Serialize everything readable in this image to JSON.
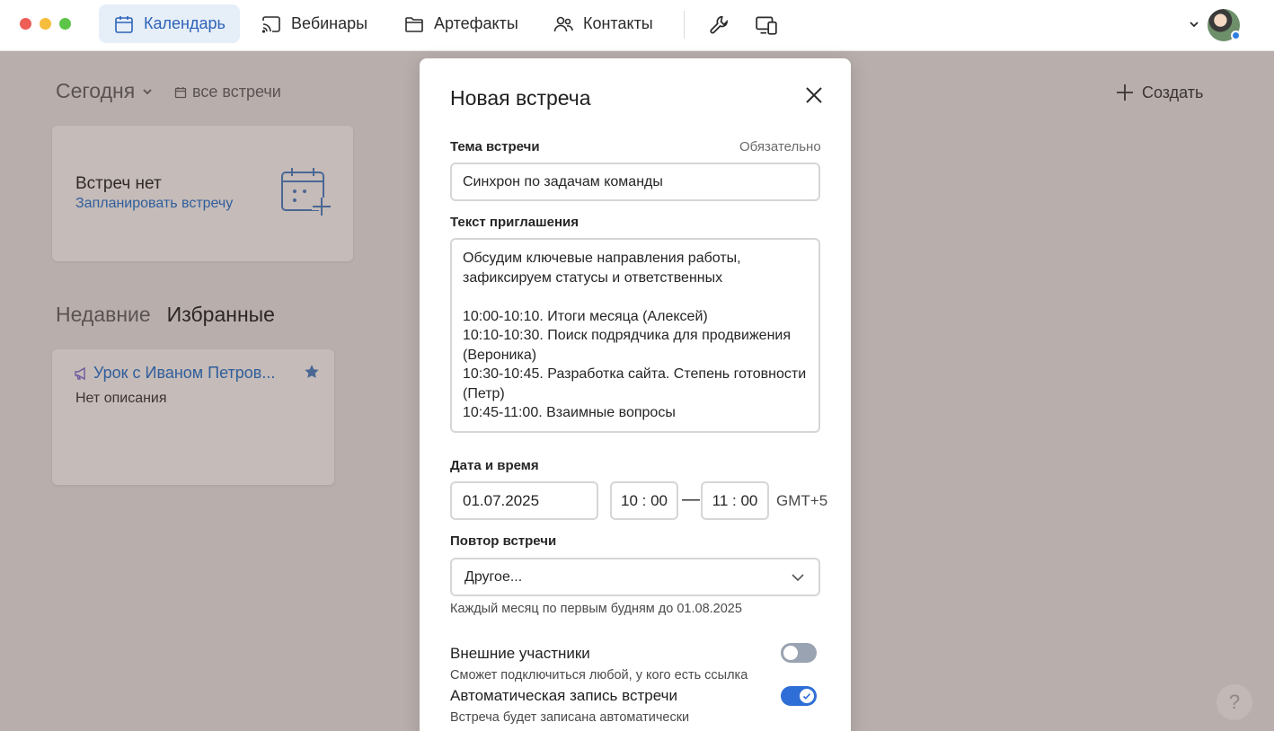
{
  "nav": {
    "items": [
      {
        "label": "Календарь",
        "icon": "calendar-icon",
        "active": true
      },
      {
        "label": "Вебинары",
        "icon": "cast-icon"
      },
      {
        "label": "Артефакты",
        "icon": "folder-icon"
      },
      {
        "label": "Контакты",
        "icon": "people-icon"
      }
    ],
    "tools": [
      "wrench-icon",
      "devices-icon"
    ]
  },
  "sidebar": {
    "today_label": "Сегодня",
    "all_meetings_label": "все встречи",
    "create_label": "Создать",
    "empty_card": {
      "title": "Встреч нет",
      "link": "Запланировать встречу"
    },
    "tabs": [
      "Недавние",
      "Избранные"
    ],
    "fav_card": {
      "title": "Урок с Иваном Петров...",
      "desc": "Нет описания"
    },
    "help": "?"
  },
  "modal": {
    "title": "Новая встреча",
    "topic_label": "Тема встречи",
    "required_label": "Обязательно",
    "topic_value": "Синхрон по задачам команды",
    "invite_label": "Текст приглашения",
    "invite_value": "Обсудим ключевые направления работы,\nзафиксируем статусы и ответственных\n\n10:00-10:10. Итоги месяца (Алексей)\n10:10-10:30. Поиск подрядчика для продвижения\n(Вероника)\n10:30-10:45. Разработка сайта. Степень готовности\n(Петр)\n10:45-11:00. Взаимные вопросы",
    "datetime_label": "Дата и время",
    "date_value": "01.07.2025",
    "time_start": "10 : 00",
    "time_dash": "—",
    "time_end": "11 : 00",
    "timezone": "GMT+5",
    "repeat_label": "Повтор встречи",
    "repeat_value": "Другое...",
    "repeat_hint": "Каждый месяц по первым будням до 01.08.2025",
    "external_label": "Внешние участники",
    "external_hint": "Сможет подключиться любой, у кого есть ссылка",
    "external_on": false,
    "record_label": "Автоматическая запись встречи",
    "record_hint": "Встреча будет записана автоматически",
    "record_on": true
  },
  "colors": {
    "accent": "#2e63b8",
    "toggle_on": "#2f6ed6",
    "overlay": "#b8aeac"
  }
}
